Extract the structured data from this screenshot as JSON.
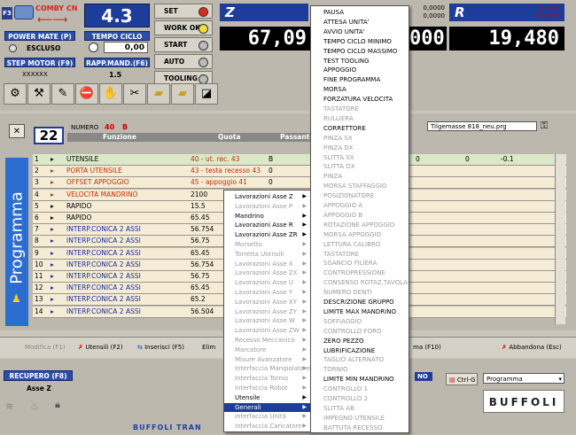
{
  "header": {
    "f3_label": "F3",
    "machine_name": "COMBY CN",
    "big_value": "4.3",
    "power_mate_label": "POWER MATE (P)",
    "tempo_ciclo_label": "TEMPO CICLO",
    "escluso_label": "ESCLUSO",
    "tempo_ciclo_value": "0,00",
    "step_motor_label": "STEP MOTOR (F9)",
    "rapp_mand_label": "RAPP.MAND.(F6)",
    "step_value": "XXXXXX",
    "rapp_value": "1.5"
  },
  "side_buttons": [
    {
      "label": "SET",
      "led": "#e02a1a"
    },
    {
      "label": "WORK OK",
      "led": "#f0e030"
    },
    {
      "label": "START",
      "led": "#bbbbbb"
    },
    {
      "label": "AUTO",
      "led": "#bbbbbb"
    },
    {
      "label": "TOOLING",
      "led": "#bbbbbb"
    }
  ],
  "axes": {
    "z_letter": "Z",
    "z_value": "67,09",
    "mid_value": "000",
    "r_letter": "R",
    "r_value": "19,480",
    "mid_small_1": "0,0000",
    "mid_small_2": "0,0000",
    "r_small_1": "2,3000",
    "r_small_2": "36,5000"
  },
  "program": {
    "number_label": "NUMERO",
    "number_value": "40",
    "number_letter": "B",
    "line_box": "22",
    "file_name": "Tilgemasse 818_neu.prg",
    "vertical_label": "Programma",
    "col_funzione": "Funzione",
    "col_quota": "Quota",
    "col_passante": "Passante",
    "rows": [
      {
        "n": "1",
        "cmd": "UTENSILE",
        "quota": "40 - ut. rec. 43",
        "p": "B",
        "v1": "0",
        "v2": "0",
        "v3": "-0.1",
        "color": "#000000",
        "bg": "#dce9c8"
      },
      {
        "n": "2",
        "cmd": "PORTA UTENSILE",
        "quota": "43 - testa recesso 43",
        "p": "0",
        "color": "#c03000",
        "bg": "#f5ecd6"
      },
      {
        "n": "3",
        "cmd": "OFFSET APPOGGIO",
        "quota": "45 - appoggio 41",
        "p": "0",
        "color": "#c03000",
        "bg": "#f5ecd6"
      },
      {
        "n": "4",
        "cmd": "VELOCITA MANDRINO",
        "quota": "2100",
        "p": "",
        "color": "#c03000",
        "bg": "#f5ecd6"
      },
      {
        "n": "5",
        "cmd": "RAPIDO",
        "quota": "15.5",
        "p": "",
        "color": "#000000",
        "bg": "#f5ecd6"
      },
      {
        "n": "6",
        "cmd": "RAPIDO",
        "quota": "65.45",
        "p": "",
        "color": "#000000",
        "bg": "#f5ecd6"
      },
      {
        "n": "7",
        "cmd": "INTERP.CONICA 2 ASSI",
        "quota": "56.754",
        "p": "",
        "color": "#1a2a9a",
        "bg": "#f5ecd6"
      },
      {
        "n": "8",
        "cmd": "INTERP.CONICA 2 ASSI",
        "quota": "56.75",
        "p": "",
        "color": "#1a2a9a",
        "bg": "#f5ecd6"
      },
      {
        "n": "9",
        "cmd": "INTERP.CONICA 2 ASSI",
        "quota": "65.45",
        "p": "",
        "color": "#1a2a9a",
        "bg": "#f5ecd6"
      },
      {
        "n": "10",
        "cmd": "INTERP.CONICA 2 ASSI",
        "quota": "56.754",
        "p": "",
        "color": "#1a2a9a",
        "bg": "#f5ecd6"
      },
      {
        "n": "11",
        "cmd": "INTERP.CONICA 2 ASSI",
        "quota": "56.75",
        "p": "",
        "color": "#1a2a9a",
        "bg": "#f5ecd6"
      },
      {
        "n": "12",
        "cmd": "INTERP.CONICA 2 ASSI",
        "quota": "65.45",
        "p": "",
        "color": "#1a2a9a",
        "bg": "#f5ecd6"
      },
      {
        "n": "13",
        "cmd": "INTERP.CONICA 2 ASSI",
        "quota": "65.2",
        "p": "",
        "color": "#1a2a9a",
        "bg": "#f5ecd6"
      },
      {
        "n": "14",
        "cmd": "INTERP.CONICA 2 ASSI",
        "quota": "56.504",
        "p": "",
        "color": "#1a2a9a",
        "bg": "#f5ecd6"
      }
    ]
  },
  "bottom": {
    "btn_modifica": "Modifica (F1)",
    "btn_utensili": "Utensili (F2)",
    "btn_inserisci": "Inserisci (F5)",
    "btn_elimina": "Elim",
    "btn_programma": "ma (F10)",
    "btn_abbandona": "Abbandona (Esc)",
    "recupero": "RECUPERO (F8)",
    "asse_z": "Asse Z",
    "footer": "BUFFOLI TRAN",
    "no_label": "NO",
    "ctrl_g": "Ctrl-G",
    "combo_value": "Programma",
    "logo": "BUFFOLI"
  },
  "context_menu": {
    "items": [
      {
        "label": "Lavorazioni Asse Z",
        "dis": false,
        "arrow": true,
        "sel": false
      },
      {
        "label": "Lavorazioni Asse P",
        "dis": true,
        "arrow": true,
        "sel": false
      },
      {
        "label": "Mandrino",
        "dis": false,
        "arrow": true,
        "sel": false
      },
      {
        "label": "Lavorazioni Asse R",
        "dis": false,
        "arrow": true,
        "sel": false
      },
      {
        "label": "Lavorazioni Asse ZR",
        "dis": false,
        "arrow": true,
        "sel": false
      },
      {
        "label": "Morsetto",
        "dis": true,
        "arrow": true,
        "sel": false
      },
      {
        "label": "Torretta Utensili",
        "dis": true,
        "arrow": true,
        "sel": false
      },
      {
        "label": "Lavorazioni Asse X",
        "dis": true,
        "arrow": true,
        "sel": false
      },
      {
        "label": "Lavorazioni Asse ZX",
        "dis": true,
        "arrow": true,
        "sel": false
      },
      {
        "label": "Lavorazioni Asse U",
        "dis": true,
        "arrow": true,
        "sel": false
      },
      {
        "label": "Lavorazioni Asse Y",
        "dis": true,
        "arrow": true,
        "sel": false
      },
      {
        "label": "Lavorazioni Asse XY",
        "dis": true,
        "arrow": true,
        "sel": false
      },
      {
        "label": "Lavorazioni Asse ZY",
        "dis": true,
        "arrow": true,
        "sel": false
      },
      {
        "label": "Lavorazioni Asse W",
        "dis": true,
        "arrow": true,
        "sel": false
      },
      {
        "label": "Lavorazioni Asse ZW",
        "dis": true,
        "arrow": true,
        "sel": false
      },
      {
        "label": "Recesso Meccanico",
        "dis": true,
        "arrow": true,
        "sel": false
      },
      {
        "label": "Marcatore",
        "dis": true,
        "arrow": true,
        "sel": false
      },
      {
        "label": "Misure Avanzatore",
        "dis": true,
        "arrow": true,
        "sel": false
      },
      {
        "label": "Interfaccia Manipolatore",
        "dis": true,
        "arrow": true,
        "sel": false
      },
      {
        "label": "Interfaccia Tornio",
        "dis": true,
        "arrow": true,
        "sel": false
      },
      {
        "label": "Interfaccia Robot",
        "dis": true,
        "arrow": true,
        "sel": false
      },
      {
        "label": "Utensile",
        "dis": false,
        "arrow": true,
        "sel": false
      },
      {
        "label": "Generali",
        "dis": false,
        "arrow": true,
        "sel": true
      },
      {
        "label": "Interfaccia Unità",
        "dis": true,
        "arrow": true,
        "sel": false
      },
      {
        "label": "Interfaccia Caricatore",
        "dis": true,
        "arrow": true,
        "sel": false
      }
    ]
  },
  "submenu": {
    "items": [
      {
        "label": "PAUSA",
        "dis": false
      },
      {
        "label": "ATTESA UNITA'",
        "dis": false
      },
      {
        "label": "AVVIO UNITA'",
        "dis": false
      },
      {
        "label": "TEMPO CICLO MINIMO",
        "dis": false
      },
      {
        "label": "TEMPO CICLO MASSIMO",
        "dis": false
      },
      {
        "label": "TEST TOOLING",
        "dis": false
      },
      {
        "label": "APPOGGIO",
        "dis": false
      },
      {
        "label": "FINE PROGRAMMA",
        "dis": false
      },
      {
        "label": "MORSA",
        "dis": false
      },
      {
        "label": "FORZATURA VELOCITA",
        "dis": false
      },
      {
        "label": "TASTATORE",
        "dis": true
      },
      {
        "label": "RULLIERA",
        "dis": true
      },
      {
        "label": "CORRETTORE",
        "dis": false
      },
      {
        "label": "PINZA SX",
        "dis": true
      },
      {
        "label": "PINZA DX",
        "dis": true
      },
      {
        "label": "SLITTA SX",
        "dis": true
      },
      {
        "label": "SLITTA DX",
        "dis": true
      },
      {
        "label": "PINZA",
        "dis": true
      },
      {
        "label": "MORSA STAFFAGGIO",
        "dis": true
      },
      {
        "label": "POSIZIONATORE",
        "dis": true
      },
      {
        "label": "APPOGGIO A",
        "dis": true
      },
      {
        "label": "APPOGGIO B",
        "dis": true
      },
      {
        "label": "ROTAZIONE APPOGGIO",
        "dis": true
      },
      {
        "label": "MORSA APPOGGIO",
        "dis": true
      },
      {
        "label": "LETTURA CALIBRO",
        "dis": true
      },
      {
        "label": "TASTATORE",
        "dis": true
      },
      {
        "label": "SGANCIO FILIERA",
        "dis": true
      },
      {
        "label": "CONTROPRESSIONE",
        "dis": true
      },
      {
        "label": "CONSENSO ROTAZ.TAVOLA",
        "dis": true
      },
      {
        "label": "NUMERO DENTI",
        "dis": true
      },
      {
        "label": "DESCRIZIONE GRUPPO",
        "dis": false
      },
      {
        "label": "LIMITE MAX MANDRINO",
        "dis": false
      },
      {
        "label": "SOFFIAGGIO",
        "dis": true
      },
      {
        "label": "CONTROLLO FORO",
        "dis": true
      },
      {
        "label": "ZERO PEZZO",
        "dis": false
      },
      {
        "label": "LUBRIFICAZIONE",
        "dis": false
      },
      {
        "label": "TAGLIO ALTERNATO",
        "dis": true
      },
      {
        "label": "TORNIO",
        "dis": true
      },
      {
        "label": "LIMITE MIN MANDRINO",
        "dis": false
      },
      {
        "label": "CONTROLLO 1",
        "dis": true
      },
      {
        "label": "CONTROLLO 2",
        "dis": true
      },
      {
        "label": "SLITTA AB",
        "dis": true
      },
      {
        "label": "IMPEGNO UTENSILE",
        "dis": true
      },
      {
        "label": "BATTUTA RECESSO",
        "dis": true
      }
    ]
  }
}
